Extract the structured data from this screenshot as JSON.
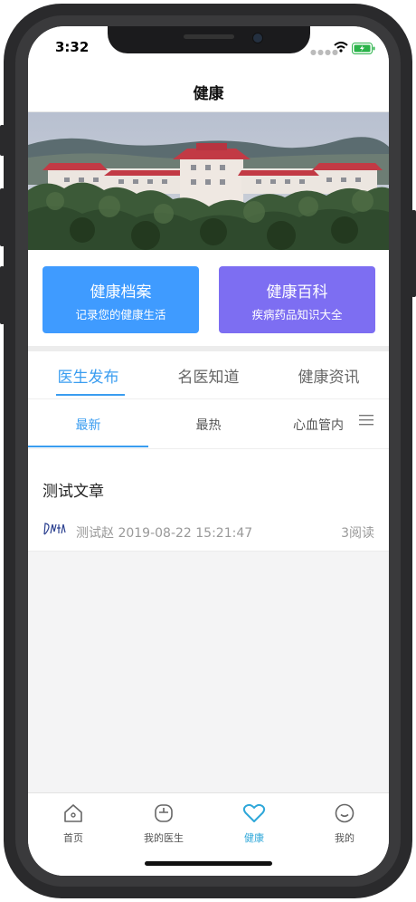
{
  "status_bar": {
    "time": "3:32"
  },
  "nav": {
    "title": "健康"
  },
  "quick_cards": [
    {
      "title": "健康档案",
      "subtitle": "记录您的健康生活",
      "color": "#3f9bff"
    },
    {
      "title": "健康百科",
      "subtitle": "疾病药品知识大全",
      "color": "#7d6ef2"
    }
  ],
  "main_tabs": [
    {
      "label": "医生发布",
      "active": true
    },
    {
      "label": "名医知道",
      "active": false
    },
    {
      "label": "健康资讯",
      "active": false
    }
  ],
  "sub_tabs": [
    {
      "label": "最新",
      "active": true
    },
    {
      "label": "最热",
      "active": false
    },
    {
      "label": "心血管内",
      "active": false
    }
  ],
  "articles": [
    {
      "title": "测试文章",
      "author": "测试赵",
      "date": "2019-08-22 15:21:47",
      "reads": "3阅读"
    }
  ],
  "tab_bar": [
    {
      "label": "首页",
      "icon": "home-icon",
      "active": false
    },
    {
      "label": "我的医生",
      "icon": "doctor-icon",
      "active": false
    },
    {
      "label": "健康",
      "icon": "heart-icon",
      "active": true
    },
    {
      "label": "我的",
      "icon": "smiley-icon",
      "active": false
    }
  ],
  "colors": {
    "accent": "#3a9df0",
    "tab_active": "#2ea7d9",
    "roof": "#c23a45"
  }
}
